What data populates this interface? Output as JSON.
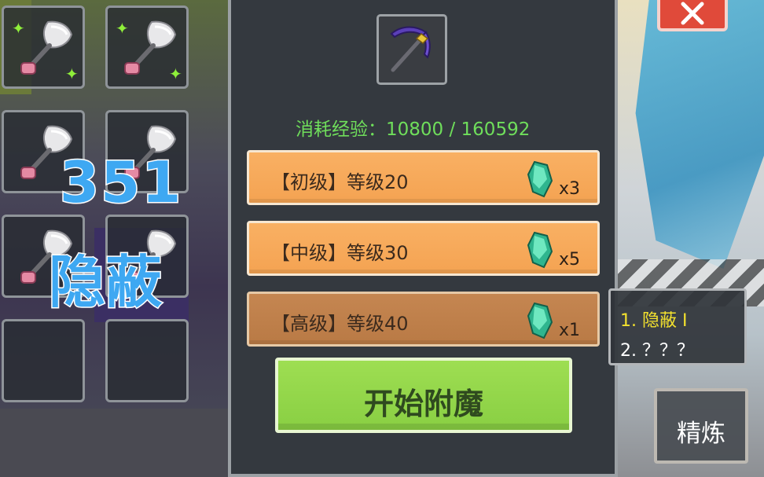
{
  "overlay": {
    "number": "351",
    "text": "隐蔽"
  },
  "inventory": {
    "slots": [
      {
        "item": "shovel-icon",
        "sparkle": true
      },
      {
        "item": "shovel-icon",
        "sparkle": true
      },
      {
        "item": "shovel-icon",
        "sparkle": false
      },
      {
        "item": "shovel-icon",
        "sparkle": false
      },
      {
        "item": "shovel-icon",
        "sparkle": false
      },
      {
        "item": "shovel-icon",
        "sparkle": false
      },
      {
        "item": null
      },
      {
        "item": null
      }
    ]
  },
  "enchant_panel": {
    "selected_item": "pickaxe-icon",
    "exp_label": "消耗经验：10800 / 160592",
    "levels": [
      {
        "label": "【初级】等级20",
        "gem": "gem-icon",
        "qty": "x3"
      },
      {
        "label": "【中级】等级30",
        "gem": "gem-icon",
        "qty": "x5"
      },
      {
        "label": "【高级】等级40",
        "gem": "gem-icon",
        "qty": "x1"
      }
    ],
    "start_button": "开始附魔"
  },
  "enchant_list": {
    "item1": "1. 隐蔽 Ⅰ",
    "item2": "2. ？？？"
  },
  "refine_button": "精炼",
  "colors": {
    "accent_orange": "#f4a352",
    "accent_green": "#89cf43",
    "exp_text": "#6fde5b",
    "enchant_highlight": "#f4e22e",
    "close_red": "#e04a3a",
    "overlay_blue": "#3ea8f2"
  }
}
